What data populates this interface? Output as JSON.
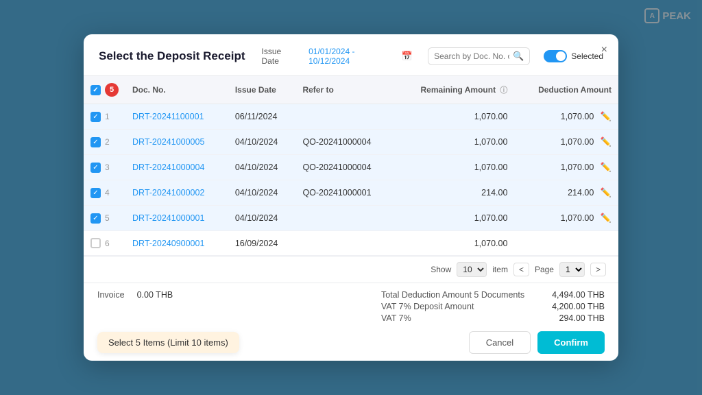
{
  "app": {
    "name": "PEAK",
    "logo_char": "A"
  },
  "modal": {
    "title": "Select the Deposit Receipt",
    "close_label": "×",
    "issue_date_label": "Issue Date",
    "issue_date_value": "01/01/2024 - 10/12/2024",
    "search_placeholder": "Search by Doc. No. or P...",
    "toggle_label": "Selected"
  },
  "table": {
    "header_badge": "5",
    "columns": [
      "Doc. No.",
      "Issue Date",
      "Refer to",
      "Remaining Amount",
      "Deduction Amount"
    ],
    "rows": [
      {
        "num": "1",
        "checked": true,
        "doc_no": "DRT-20241100001",
        "issue_date": "06/11/2024",
        "refer_to": "",
        "remaining": "1,070.00",
        "deduction": "1,070.00"
      },
      {
        "num": "2",
        "checked": true,
        "doc_no": "DRT-20241000005",
        "issue_date": "04/10/2024",
        "refer_to": "QO-20241000004",
        "remaining": "1,070.00",
        "deduction": "1,070.00"
      },
      {
        "num": "3",
        "checked": true,
        "doc_no": "DRT-20241000004",
        "issue_date": "04/10/2024",
        "refer_to": "QO-20241000004",
        "remaining": "1,070.00",
        "deduction": "1,070.00"
      },
      {
        "num": "4",
        "checked": true,
        "doc_no": "DRT-20241000002",
        "issue_date": "04/10/2024",
        "refer_to": "QO-20241000001",
        "remaining": "214.00",
        "deduction": "214.00"
      },
      {
        "num": "5",
        "checked": true,
        "doc_no": "DRT-20241000001",
        "issue_date": "04/10/2024",
        "refer_to": "",
        "remaining": "1,070.00",
        "deduction": "1,070.00"
      },
      {
        "num": "6",
        "checked": false,
        "doc_no": "DRT-20240900001",
        "issue_date": "16/09/2024",
        "refer_to": "",
        "remaining": "1,070.00",
        "deduction": ""
      }
    ]
  },
  "pagination": {
    "show_label": "Show",
    "show_value": "10",
    "item_label": "item",
    "page_label": "Page",
    "page_value": "1",
    "prev_btn": "<",
    "next_btn": ">"
  },
  "footer": {
    "invoice_label": "Invoice",
    "invoice_amount": "0.00 THB",
    "total_deduction_label": "Total Deduction Amount 5 Documents",
    "total_deduction_value": "4,494.00 THB",
    "vat_deposit_label": "VAT 7% Deposit Amount",
    "vat_deposit_value": "4,200.00 THB",
    "vat_label": "VAT 7%",
    "vat_value": "294.00 THB",
    "select_info": "Select 5 Items (Limit 10 items)",
    "cancel_label": "Cancel",
    "confirm_label": "Confirm"
  }
}
